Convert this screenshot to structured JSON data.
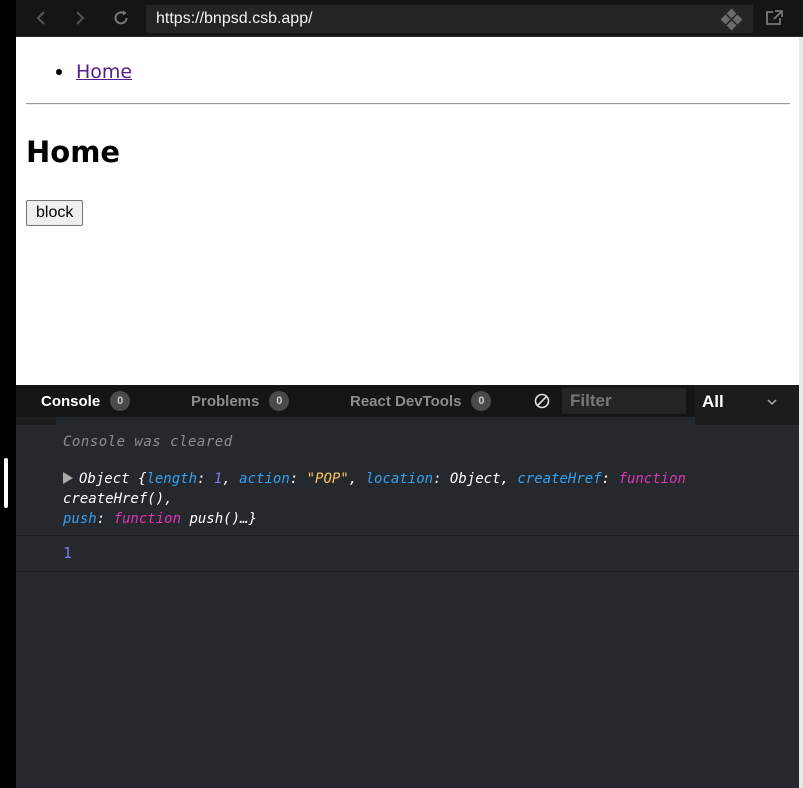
{
  "browser": {
    "url": "https://bnpsd.csb.app/"
  },
  "page": {
    "nav_links": [
      {
        "label": "Home"
      }
    ],
    "heading": "Home",
    "block_button": "block"
  },
  "devtools": {
    "tabs": [
      {
        "label": "Console",
        "count": "0",
        "active": true
      },
      {
        "label": "Problems",
        "count": "0",
        "active": false
      },
      {
        "label": "React DevTools",
        "count": "0",
        "active": false
      }
    ],
    "filter_placeholder": "Filter",
    "level": "All",
    "console": {
      "cleared_message": "Console was cleared",
      "log_object": {
        "label": "Object",
        "length": "1",
        "action": "\"POP\"",
        "location": "Object",
        "create_href_fn": "createHref()",
        "push_fn": "push()…"
      },
      "output_value": "1"
    }
  },
  "colors": {
    "key": "#34a0f0",
    "number": "#7c7ce8",
    "string": "#f6c65b",
    "keyword": "#dd36b5",
    "link": "#551a8b"
  }
}
